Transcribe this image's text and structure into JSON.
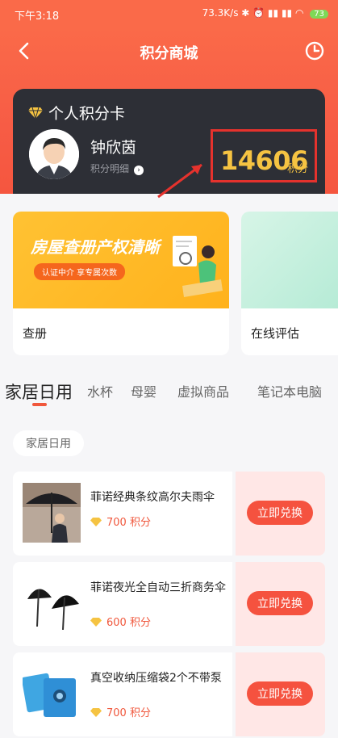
{
  "status": {
    "time": "下午3:18",
    "network": "73.3K/s",
    "battery": "73"
  },
  "header": {
    "title": "积分商城",
    "back_icon": "chevron-left-icon",
    "history_icon": "clock-icon"
  },
  "card": {
    "title": "个人积分卡",
    "user_name": "钟欣茵",
    "detail_label": "积分明细",
    "points": "14606",
    "points_unit": "积分"
  },
  "banners": [
    {
      "label": "查册",
      "ad_text": "房屋查册产权清晰",
      "ad_tag": "认证中介 享专属次数"
    },
    {
      "label": "在线评估"
    }
  ],
  "tabs": [
    "家居日用",
    "水杯",
    "母婴",
    "虚拟商品",
    "笔记本电脑"
  ],
  "active_tab": "家居日用",
  "category_chip": "家居日用",
  "products": [
    {
      "name": "菲诺经典条纹高尔夫雨伞",
      "price": "700 积分",
      "button": "立即兑换"
    },
    {
      "name": "菲诺夜光全自动三折商务伞",
      "price": "600 积分",
      "button": "立即兑换"
    },
    {
      "name": "真空收纳压缩袋2个不带泵",
      "price": "700 积分",
      "button": "立即兑换"
    }
  ],
  "colors": {
    "accent": "#f5523f",
    "header": "#fa6a49",
    "card": "#2d2f36",
    "points": "#f5c342",
    "highlight_box": "#e5322d"
  }
}
